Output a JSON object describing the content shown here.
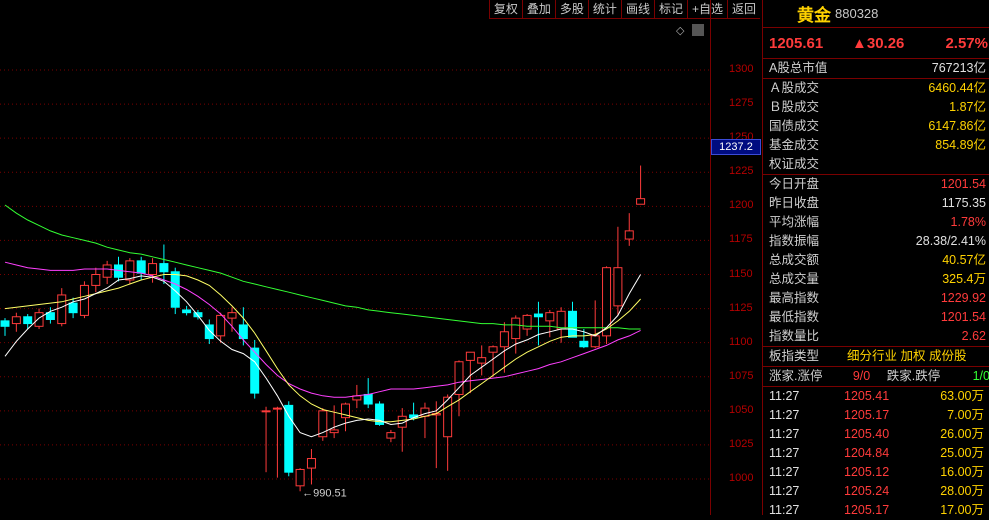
{
  "toolbar": {
    "buttons": [
      "复权",
      "叠加",
      "多股",
      "统计",
      "画线",
      "标记",
      "+自选",
      "返回"
    ]
  },
  "chart": {
    "price_ticks": [
      "1300",
      "1275",
      "1250",
      "1225",
      "1200",
      "1175",
      "1150",
      "1125",
      "1100",
      "1075",
      "1050",
      "1025",
      "1000"
    ],
    "current_price_label": "1237.2",
    "low_annotation": "←990.51",
    "colors": {
      "up": "#ff3b3b",
      "down": "#00ffff",
      "ma5": "#ffffff",
      "ma10": "#ffff66",
      "ma20": "#ff40ff",
      "ma60": "#33ff33",
      "grid": "#7a0000"
    }
  },
  "chart_data": {
    "type": "candlestick",
    "y_range": [
      990,
      1310
    ],
    "ticks": [
      1000,
      1025,
      1050,
      1075,
      1100,
      1125,
      1150,
      1175,
      1200,
      1225,
      1250,
      1275,
      1300
    ],
    "candles": [
      [
        1116,
        1118,
        1105,
        1112
      ],
      [
        1114,
        1122,
        1108,
        1119
      ],
      [
        1119,
        1121,
        1110,
        1114
      ],
      [
        1112,
        1125,
        1110,
        1122
      ],
      [
        1122,
        1126,
        1114,
        1117
      ],
      [
        1114,
        1140,
        1112,
        1135
      ],
      [
        1129,
        1133,
        1118,
        1122
      ],
      [
        1120,
        1145,
        1118,
        1142
      ],
      [
        1142,
        1155,
        1137,
        1150
      ],
      [
        1148,
        1160,
        1143,
        1157
      ],
      [
        1157,
        1163,
        1145,
        1148
      ],
      [
        1146,
        1162,
        1143,
        1160
      ],
      [
        1160,
        1163,
        1146,
        1151
      ],
      [
        1150,
        1162,
        1144,
        1158
      ],
      [
        1158,
        1172,
        1143,
        1152
      ],
      [
        1152,
        1155,
        1121,
        1126
      ],
      [
        1124,
        1127,
        1120,
        1122
      ],
      [
        1122,
        1124,
        1117,
        1119
      ],
      [
        1113,
        1117,
        1099,
        1103
      ],
      [
        1105,
        1122,
        1100,
        1120
      ],
      [
        1118,
        1126,
        1108,
        1122
      ],
      [
        1113,
        1126,
        1098,
        1103
      ],
      [
        1096,
        1102,
        1059,
        1063
      ],
      [
        1050,
        1053,
        1005,
        1050
      ],
      [
        1052,
        1053,
        1001,
        1052
      ],
      [
        1054,
        1057,
        1002,
        1005
      ],
      [
        995,
        1008,
        991,
        1007
      ],
      [
        1008,
        1022,
        996,
        1015
      ],
      [
        1031,
        1052,
        1028,
        1050
      ],
      [
        1034,
        1054,
        1030,
        1036
      ],
      [
        1045,
        1056,
        1035,
        1055
      ],
      [
        1058,
        1069,
        1052,
        1061
      ],
      [
        1062,
        1074,
        1052,
        1055
      ],
      [
        1055,
        1057,
        1039,
        1040
      ],
      [
        1030,
        1036,
        1027,
        1034
      ],
      [
        1038,
        1052,
        1020,
        1046
      ],
      [
        1047,
        1056,
        1043,
        1045
      ],
      [
        1046,
        1056,
        1030,
        1052
      ],
      [
        1047,
        1057,
        1008,
        1048
      ],
      [
        1031,
        1062,
        1006,
        1060
      ],
      [
        1062,
        1087,
        1046,
        1086
      ],
      [
        1087,
        1093,
        1063,
        1093
      ],
      [
        1085,
        1098,
        1076,
        1089
      ],
      [
        1093,
        1098,
        1075,
        1097
      ],
      [
        1097,
        1115,
        1078,
        1108
      ],
      [
        1103,
        1120,
        1092,
        1118
      ],
      [
        1110,
        1121,
        1105,
        1120
      ],
      [
        1121,
        1130,
        1098,
        1119
      ],
      [
        1116,
        1124,
        1104,
        1122
      ],
      [
        1110,
        1126,
        1100,
        1123
      ],
      [
        1123,
        1130,
        1104,
        1104
      ],
      [
        1101,
        1110,
        1096,
        1097
      ],
      [
        1097,
        1131,
        1096,
        1105
      ],
      [
        1105,
        1156,
        1099,
        1155
      ],
      [
        1127,
        1185,
        1120,
        1155
      ],
      [
        1176,
        1195,
        1171,
        1182
      ],
      [
        1201.54,
        1229.92,
        1201.54,
        1205.61
      ]
    ],
    "ma5": [
      1090,
      1101,
      1110,
      1118,
      1123,
      1126,
      1130,
      1132,
      1136,
      1140,
      1146,
      1147,
      1149,
      1148,
      1145,
      1138,
      1130,
      1120,
      1109,
      1101,
      1095,
      1092,
      1086,
      1074,
      1061,
      1046,
      1034,
      1031,
      1034,
      1038,
      1041,
      1043,
      1044,
      1043,
      1040,
      1041,
      1045,
      1048,
      1050,
      1058,
      1067,
      1076,
      1082,
      1088,
      1094,
      1099,
      1102,
      1106,
      1108,
      1110,
      1110,
      1108,
      1105,
      1111,
      1120,
      1136,
      1150
    ],
    "ma10": [
      1125,
      1126,
      1127,
      1128,
      1129,
      1130,
      1132,
      1134,
      1136,
      1138,
      1140,
      1143,
      1146,
      1148,
      1150,
      1150,
      1149,
      1146,
      1142,
      1135,
      1127,
      1118,
      1107,
      1094,
      1081,
      1069,
      1061,
      1055,
      1051,
      1049,
      1047,
      1045,
      1043,
      1042,
      1042,
      1043,
      1044,
      1046,
      1048,
      1053,
      1058,
      1064,
      1070,
      1076,
      1082,
      1088,
      1093,
      1097,
      1101,
      1104,
      1105,
      1105,
      1106,
      1110,
      1116,
      1123,
      1132
    ],
    "ma20": [
      1159,
      1157,
      1155,
      1154,
      1153,
      1153,
      1153,
      1154,
      1154,
      1154,
      1153,
      1152,
      1151,
      1149,
      1146,
      1143,
      1139,
      1134,
      1128,
      1121,
      1112,
      1102,
      1093,
      1084,
      1076,
      1070,
      1066,
      1063,
      1061,
      1060,
      1060,
      1061,
      1062,
      1064,
      1066,
      1066,
      1066,
      1067,
      1068,
      1069,
      1071,
      1072,
      1073,
      1074,
      1075,
      1077,
      1079,
      1081,
      1084,
      1086,
      1089,
      1092,
      1095,
      1098,
      1102,
      1105,
      1109
    ],
    "ma60": [
      1201,
      1195,
      1190,
      1186,
      1182,
      1179,
      1177,
      1175,
      1173,
      1170,
      1168,
      1166,
      1165,
      1163,
      1161,
      1159,
      1157,
      1155,
      1153,
      1151,
      1148,
      1145,
      1143,
      1141,
      1139,
      1137,
      1135,
      1133,
      1131,
      1129,
      1127,
      1126,
      1124,
      1123,
      1122,
      1121,
      1120,
      1119,
      1118,
      1117,
      1116,
      1115,
      1114,
      1114,
      1113,
      1113,
      1112,
      1112,
      1112,
      1111,
      1111,
      1111,
      1111,
      1111,
      1111,
      1110,
      1110
    ]
  },
  "panel": {
    "name": "黄金",
    "code": "880328",
    "last": "1205.61",
    "change": "▲30.26",
    "change_pct": "2.57%",
    "market_cap_label": "A股总市值",
    "market_cap_value": "767213亿",
    "turnover": [
      {
        "label": "Ａ股成交",
        "value": "6460.44亿"
      },
      {
        "label": "Ｂ股成交",
        "value": "1.87亿"
      },
      {
        "label": "国债成交",
        "value": "6147.86亿"
      },
      {
        "label": "基金成交",
        "value": "854.89亿"
      },
      {
        "label": "权证成交",
        "value": ""
      }
    ],
    "stats": [
      {
        "label": "今日开盘",
        "value": "1201.54",
        "color": "red"
      },
      {
        "label": "昨日收盘",
        "value": "1175.35",
        "color": "white"
      },
      {
        "label": "平均涨幅",
        "value": "1.78%",
        "color": "red"
      },
      {
        "label": "指数振幅",
        "value": "28.38/2.41%",
        "color": "white"
      },
      {
        "label": "总成交额",
        "value": "40.57亿",
        "color": "yellow"
      },
      {
        "label": "总成交量",
        "value": "325.4万",
        "color": "yellow"
      },
      {
        "label": "最高指数",
        "value": "1229.92",
        "color": "red"
      },
      {
        "label": "最低指数",
        "value": "1201.54",
        "color": "red"
      },
      {
        "label": "指数量比",
        "value": "2.62",
        "color": "red"
      }
    ],
    "sector_label": "板指类型",
    "sector_value": "细分行业 加权 成份股",
    "updown_label": "涨家.涨停",
    "updown_value": "9/0",
    "downs_label": "跌家.跌停",
    "downs_value": "1/0",
    "trades": [
      {
        "time": "11:27",
        "price": "1205.41",
        "qty": "63.00万"
      },
      {
        "time": "11:27",
        "price": "1205.17",
        "qty": "7.00万"
      },
      {
        "time": "11:27",
        "price": "1205.40",
        "qty": "26.00万"
      },
      {
        "time": "11:27",
        "price": "1204.84",
        "qty": "25.00万"
      },
      {
        "time": "11:27",
        "price": "1205.12",
        "qty": "16.00万"
      },
      {
        "time": "11:27",
        "price": "1205.24",
        "qty": "28.00万"
      },
      {
        "time": "11:27",
        "price": "1205.17",
        "qty": "17.00万"
      }
    ]
  }
}
